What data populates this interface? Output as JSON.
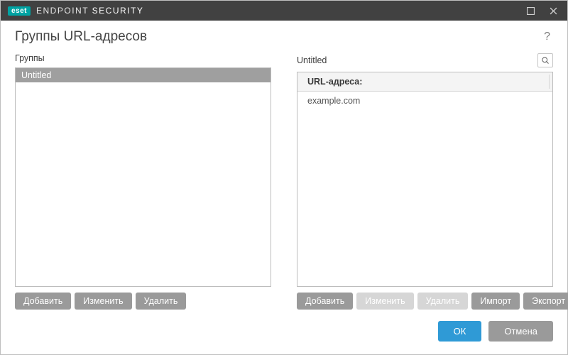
{
  "titlebar": {
    "badge": "eset",
    "product_a": "ENDPOINT",
    "product_b": "SECURITY"
  },
  "page": {
    "title": "Группы URL-адресов"
  },
  "left": {
    "label": "Группы",
    "items": [
      "Untitled"
    ],
    "buttons": {
      "add": "Добавить",
      "edit": "Изменить",
      "delete": "Удалить"
    }
  },
  "right": {
    "label": "Untitled",
    "column_header": "URL-адреса:",
    "rows": [
      "example.com"
    ],
    "buttons": {
      "add": "Добавить",
      "edit": "Изменить",
      "delete": "Удалить",
      "import": "Импорт",
      "export": "Экспорт"
    }
  },
  "footer": {
    "ok": "ОК",
    "cancel": "Отмена"
  }
}
